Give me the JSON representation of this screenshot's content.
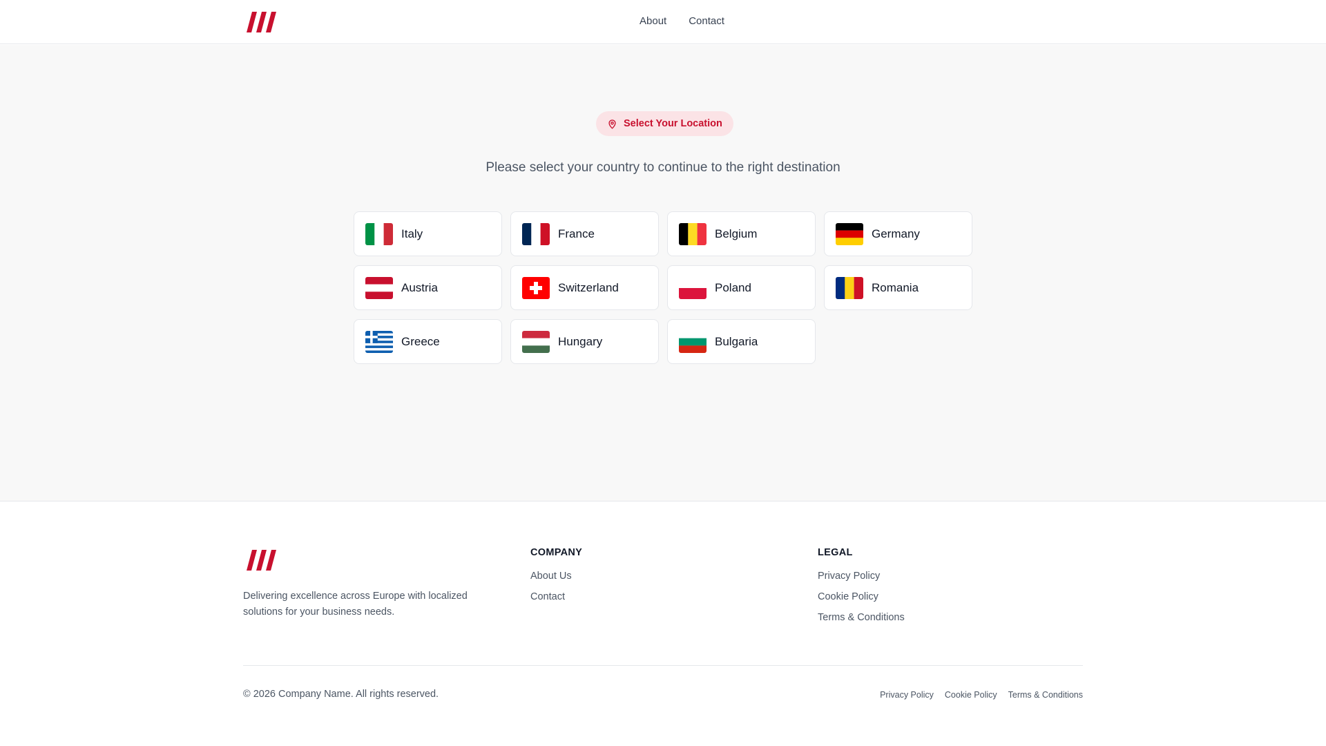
{
  "header": {
    "nav": [
      "About",
      "Contact"
    ]
  },
  "main": {
    "badge_label": "Select Your Location",
    "subtitle": "Please select your country to continue to the right destination",
    "countries": [
      "Italy",
      "France",
      "Belgium",
      "Germany",
      "Austria",
      "Switzerland",
      "Poland",
      "Romania",
      "Greece",
      "Hungary",
      "Bulgaria"
    ]
  },
  "footer": {
    "description": "Delivering excellence across Europe with localized solutions for your business needs.",
    "company": {
      "heading": "COMPANY",
      "links": [
        "About Us",
        "Contact"
      ]
    },
    "legal": {
      "heading": "LEGAL",
      "links": [
        "Privacy Policy",
        "Cookie Policy",
        "Terms & Conditions"
      ]
    },
    "copyright": "© 2026 Company Name. All rights reserved.",
    "bottom_links": [
      "Privacy Policy",
      "Cookie Policy",
      "Terms & Conditions"
    ]
  },
  "colors": {
    "brand_red": "#c8102e",
    "badge_bg": "#fbe3e6",
    "page_bg": "#f8f8f8"
  }
}
